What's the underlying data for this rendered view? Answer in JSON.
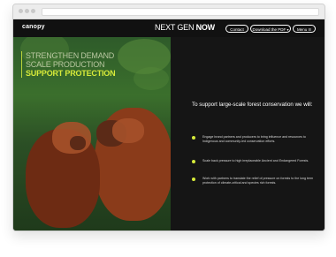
{
  "header": {
    "logo": "canopy",
    "brand": {
      "light": "NEXT GEN",
      "bold": "NOW"
    },
    "buttons": {
      "contact": "Contact",
      "download": "Download the PDF",
      "menu": "Menu"
    },
    "icons": {
      "download": "chevron-down-icon",
      "menu": "menu-icon"
    }
  },
  "hero": {
    "headlines": [
      "STRENGTHEN DEMAND",
      "SCALE PRODUCTION",
      "SUPPORT PROTECTION"
    ],
    "active_index": 2,
    "accent_color": "#d7ea3a"
  },
  "panel": {
    "title": "To support large-scale forest conservation we will:",
    "items": [
      "Engage brand partners and producers to bring influence and resources to Indigenous and community-led conservation efforts.",
      "Scale back pressure to high irreplaceable Ancient and Endangered Forests.",
      "Work with partners to translate the relief of pressure on forests to the long term protection of climate-critical and species rich forests."
    ]
  }
}
